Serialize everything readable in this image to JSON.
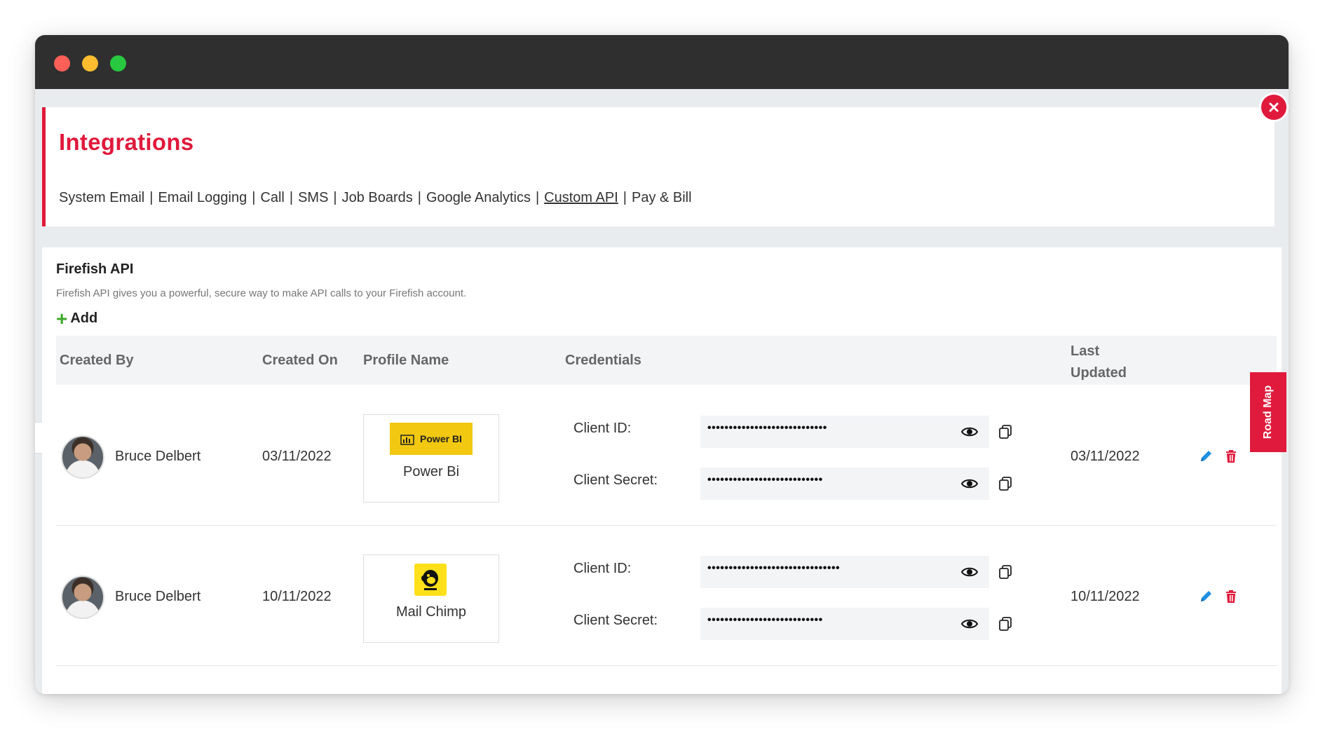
{
  "header": {
    "title": "Integrations",
    "tabs": [
      {
        "label": "System Email"
      },
      {
        "label": "Email Logging"
      },
      {
        "label": "Call"
      },
      {
        "label": "SMS"
      },
      {
        "label": "Job Boards"
      },
      {
        "label": "Google Analytics"
      },
      {
        "label": "Custom API",
        "active": true
      },
      {
        "label": "Pay & Bill"
      }
    ],
    "separator": "|"
  },
  "section": {
    "title": "Firefish API",
    "description": "Firefish API gives you a powerful, secure way to make API calls to your Firefish account.",
    "add_label": "Add"
  },
  "table": {
    "columns": {
      "created_by": "Created By",
      "created_on": "Created On",
      "profile_name": "Profile Name",
      "credentials": "Credentials",
      "last_updated": "Last Updated"
    },
    "rows": [
      {
        "created_by": "Bruce Delbert",
        "created_on": "03/11/2022",
        "profile_logo_text": "Power BI",
        "profile_name": "Power Bi",
        "client_id_label": "Client ID:",
        "client_id_masked": "••••••••••••••••••••••••••••",
        "client_secret_label": "Client Secret:",
        "client_secret_masked": "•••••••••••••••••••••••••••",
        "last_updated": "03/11/2022"
      },
      {
        "created_by": "Bruce Delbert",
        "created_on": "10/11/2022",
        "profile_logo_text": "",
        "profile_name": "Mail Chimp",
        "client_id_label": "Client ID:",
        "client_id_masked": "•••••••••••••••••••••••••••••••",
        "client_secret_label": "Client Secret:",
        "client_secret_masked": "•••••••••••••••••••••••••••",
        "last_updated": "10/11/2022"
      }
    ]
  },
  "road_map_label": "Road Map",
  "colors": {
    "accent": "#e01a3c",
    "add_plus": "#3da82a",
    "edit_icon": "#1f8fe0",
    "powerbi_yellow": "#f2c811",
    "mailchimp_yellow": "#ffe01b"
  }
}
